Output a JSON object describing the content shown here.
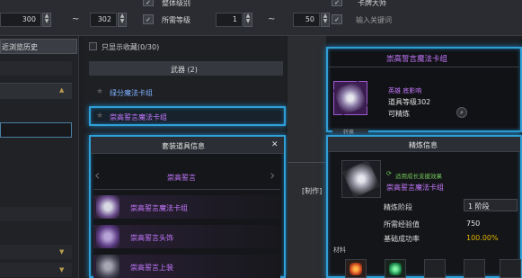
{
  "top_filters": {
    "header_left": "整体级别",
    "header_right": "卡牌大师",
    "level_from": "300",
    "tilde1": "~",
    "level_to": "302",
    "required_level_label": "所需等级",
    "req_from": "1",
    "tilde2": "~",
    "req_to": "50",
    "keyword_placeholder": "输入关键词"
  },
  "left_panel": {
    "recent_history": "近浏览历史"
  },
  "middle_panel": {
    "show_favorites": "只显示收藏(0/30)",
    "category": "武器 (2)",
    "items": [
      {
        "name": "绿分魔法卡组"
      },
      {
        "name": "崇高誓言魔法卡组"
      }
    ]
  },
  "set_popup": {
    "title": "套装道具信息",
    "close": "✕",
    "set_name": "崇高誓言",
    "items": [
      {
        "name": "崇高誓言魔法卡组"
      },
      {
        "name": "崇高誓言头饰"
      },
      {
        "name": "崇高誓言上装"
      }
    ]
  },
  "craft_text": "[制作]",
  "item_tooltip": {
    "title": "崇高誓言魔法卡组",
    "grade": "英雄 底影响",
    "item_level": "道具等级302",
    "refinable": "可精炼",
    "tab": "转换"
  },
  "refine_panel": {
    "title": "精炼信息",
    "note": "适用成长支援效果",
    "item_name": "崇高誓言魔法卡组",
    "rows": [
      {
        "label": "精炼阶段",
        "value": "1 阶段"
      },
      {
        "label": "所需经验值",
        "value": "750"
      },
      {
        "label": "基础成功率",
        "value": "100.00%"
      }
    ],
    "materials_label": "材料"
  },
  "colors": {
    "accent_blue": "#2f9fd6",
    "purple_name": "#c478ff",
    "gold": "#e2b400"
  }
}
